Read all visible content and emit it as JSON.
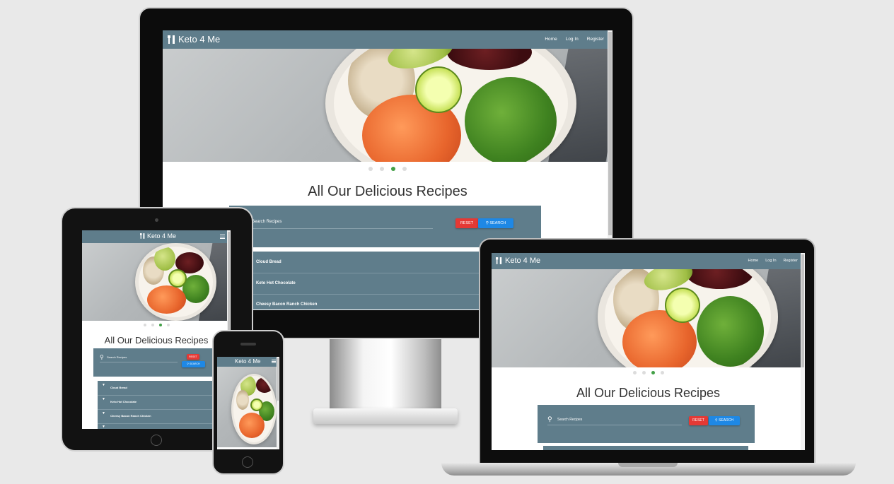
{
  "site": {
    "brand": "Keto 4 Me",
    "nav": [
      "Home",
      "Log In",
      "Register"
    ],
    "heading": "All Our Delicious Recipes",
    "search_label": "Search Recipes",
    "reset_label": "RESET",
    "search_button_label": "SEARCH",
    "recipes": [
      "Cloud Bread",
      "Keto Hot Chocolate",
      "Cheesy Bacon Ranch Chicken"
    ],
    "carousel": {
      "slides": 4,
      "active_index": 3
    }
  },
  "colors": {
    "page_background": "#e9e9e9",
    "navbar": "#5f7d8b",
    "reset_button": "#e53935",
    "search_button": "#1e88e5",
    "carousel_active": "#43a047"
  },
  "icons": {
    "brand": "utensils-icon",
    "search": "search-icon",
    "menu": "hamburger-menu-icon",
    "expand": "caret-down-icon"
  }
}
